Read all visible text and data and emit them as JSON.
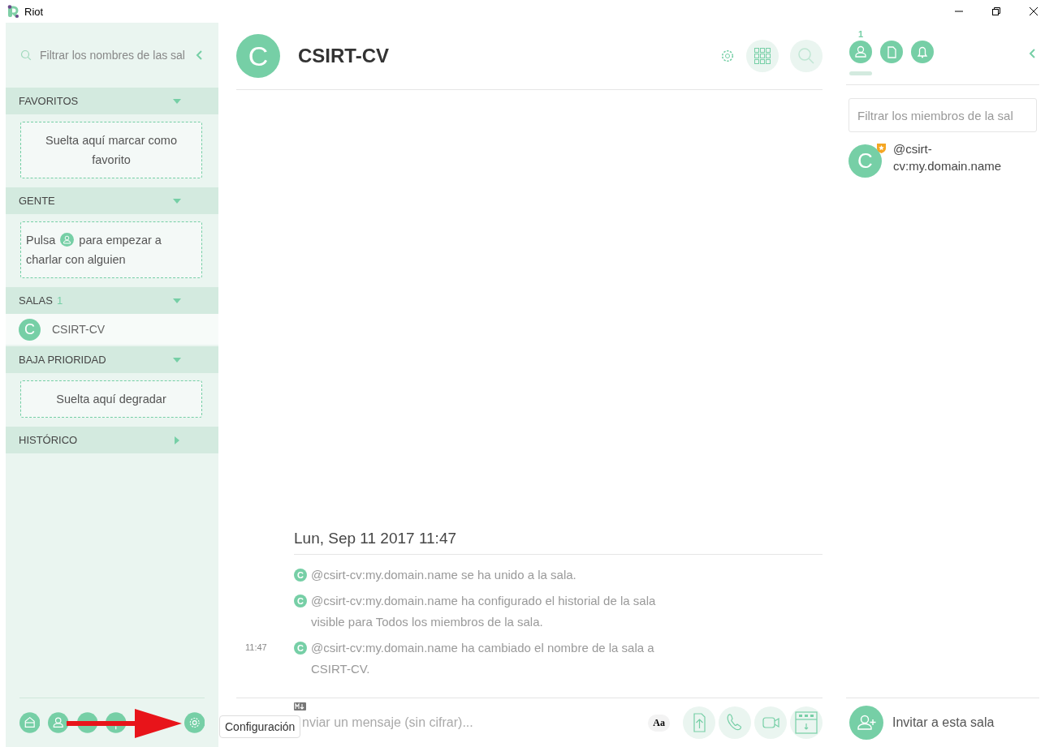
{
  "window": {
    "title": "Riot"
  },
  "sidebar": {
    "search": {
      "placeholder": "Filtrar los nombres de las sal"
    },
    "sections": [
      {
        "title": "FAVORITOS",
        "expanded": true,
        "kind": "drop",
        "drop_text": "Suelta aquí marcar como favorito"
      },
      {
        "title": "GENTE",
        "expanded": true,
        "kind": "hint",
        "hint_before": "Pulsa",
        "hint_after": "para empezar a charlar con alguien"
      },
      {
        "title": "SALAS",
        "count": "1",
        "expanded": true,
        "kind": "rooms",
        "rooms": [
          {
            "avatar": "C",
            "name": "CSIRT-CV",
            "selected": false
          }
        ]
      },
      {
        "title": "BAJA PRIORIDAD",
        "expanded": true,
        "kind": "drop",
        "drop_text": "Suelta aquí degradar"
      },
      {
        "title": "HISTÓRICO",
        "expanded": false
      }
    ],
    "tooltip": "Configuración"
  },
  "room": {
    "avatar": "C",
    "name": "CSIRT-CV",
    "date": "Lun, Sep 11 2017 11:47",
    "events": [
      {
        "avatar": "C",
        "text": "@csirt-cv:my.domain.name se ha unido a la sala."
      },
      {
        "avatar": "C",
        "text": "@csirt-cv:my.domain.name ha configurado el historial de la sala visible para Todos los miembros de la sala."
      },
      {
        "time": "11:47",
        "avatar": "C",
        "text": "@csirt-cv:my.domain.name ha cambiado el nombre de la sala a CSIRT-CV."
      }
    ]
  },
  "composer": {
    "placeholder": "nviar un mensaje (sin cifrar)...",
    "format_button": "Aa"
  },
  "right_panel": {
    "tabs": [
      {
        "kind": "members",
        "count": "1",
        "selected": true
      },
      {
        "kind": "files",
        "selected": false
      },
      {
        "kind": "notifications",
        "selected": false
      }
    ],
    "filter": {
      "placeholder": "Filtrar los miembros de la sal"
    },
    "members": [
      {
        "avatar": "C",
        "name": "@csirt-cv:my.domain.name",
        "admin": true
      }
    ],
    "invite": "Invitar a esta sala"
  }
}
